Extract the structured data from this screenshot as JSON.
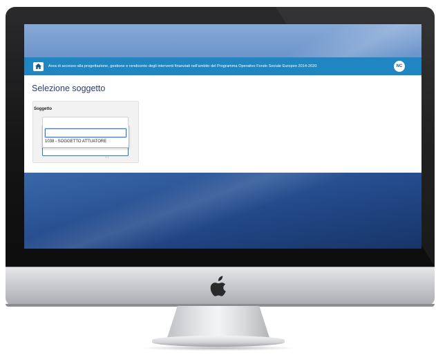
{
  "header": {
    "banner_text": "Area di accesso alla progettazione, gestione e rendiconto degli interventi finanziati nell'ambito del Programma Operativo Fondo Sociale Europeo 2014-2020",
    "home_icon": "home-icon",
    "user_initials": "NC"
  },
  "page": {
    "title": "Selezione soggetto"
  },
  "form": {
    "field_label": "Soggetto",
    "search_value": "",
    "options": [
      "1038 - SOGGETTO ATTUATORE"
    ]
  },
  "colors": {
    "topbar": "#1f86c1",
    "title": "#2b3d76",
    "focus_border": "#3478d4"
  },
  "device": {
    "logo_icon": "apple-logo-icon"
  }
}
